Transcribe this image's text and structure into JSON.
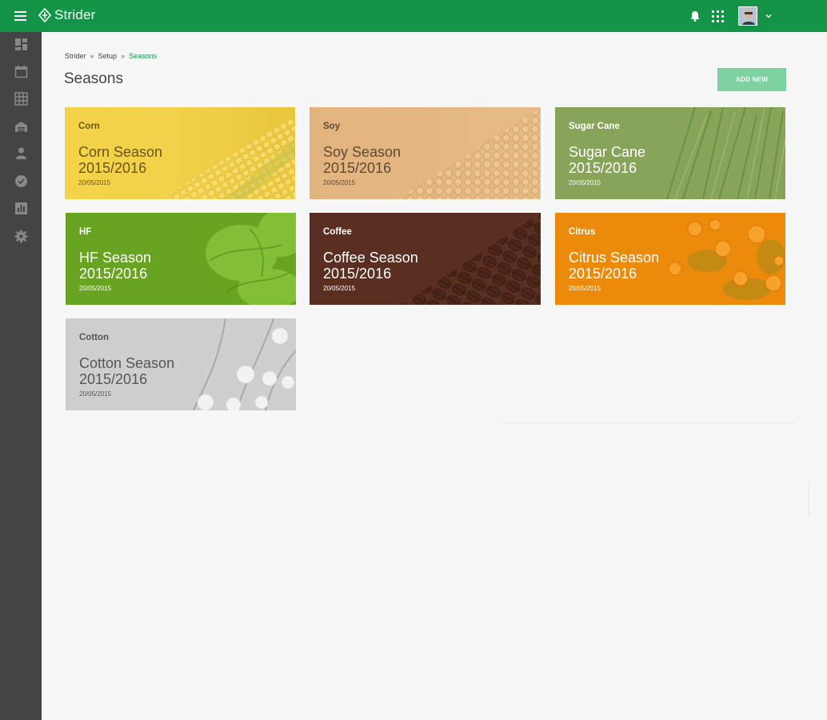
{
  "app": {
    "name": "Strider"
  },
  "breadcrumb": {
    "items": [
      "Strider",
      "Setup",
      "Seasons"
    ],
    "separator": "»"
  },
  "page": {
    "title": "Seasons",
    "add_button": "ADD NEW"
  },
  "colors": {
    "brand": "#149447",
    "sidebar": "#444444",
    "add_button": "#7ed2a2"
  },
  "sidebar": {
    "items": [
      {
        "icon": "dashboard-icon"
      },
      {
        "icon": "calendar-icon"
      },
      {
        "icon": "grid-icon"
      },
      {
        "icon": "warehouse-icon"
      },
      {
        "icon": "person-icon"
      },
      {
        "icon": "check-circle-icon"
      },
      {
        "icon": "report-icon"
      },
      {
        "icon": "gear-icon"
      }
    ]
  },
  "header_icons": [
    "bell-icon",
    "apps-grid-icon",
    "avatar",
    "chevron-down-icon"
  ],
  "seasons": [
    {
      "name": "Corn",
      "season_line1": "Corn Season",
      "season_line2": "2015/2016",
      "date": "20/05/2015",
      "color": "#f3d44e"
    },
    {
      "name": "Soy",
      "season_line1": "Soy Season",
      "season_line2": "2015/2016",
      "date": "20/05/2015",
      "color": "#e4b680"
    },
    {
      "name": "Sugar Cane",
      "season_line1": "Sugar Cane",
      "season_line2": "2015/2016",
      "date": "20/05/2015",
      "color": "#89a45b"
    },
    {
      "name": "HF",
      "season_line1": "HF Season",
      "season_line2": "2015/2016",
      "date": "20/05/2015",
      "color": "#69a522"
    },
    {
      "name": "Coffee",
      "season_line1": "Coffee Season",
      "season_line2": "2015/2016",
      "date": "20/05/2015",
      "color": "#5a2e20"
    },
    {
      "name": "Citrus",
      "season_line1": "Citrus Season",
      "season_line2": "2015/2016",
      "date": "20/05/2015",
      "color": "#ec8a0d"
    },
    {
      "name": "Cotton",
      "season_line1": "Cotton Season",
      "season_line2": "2015/2016",
      "date": "20/05/2015",
      "color": "#cfcfd1"
    }
  ]
}
